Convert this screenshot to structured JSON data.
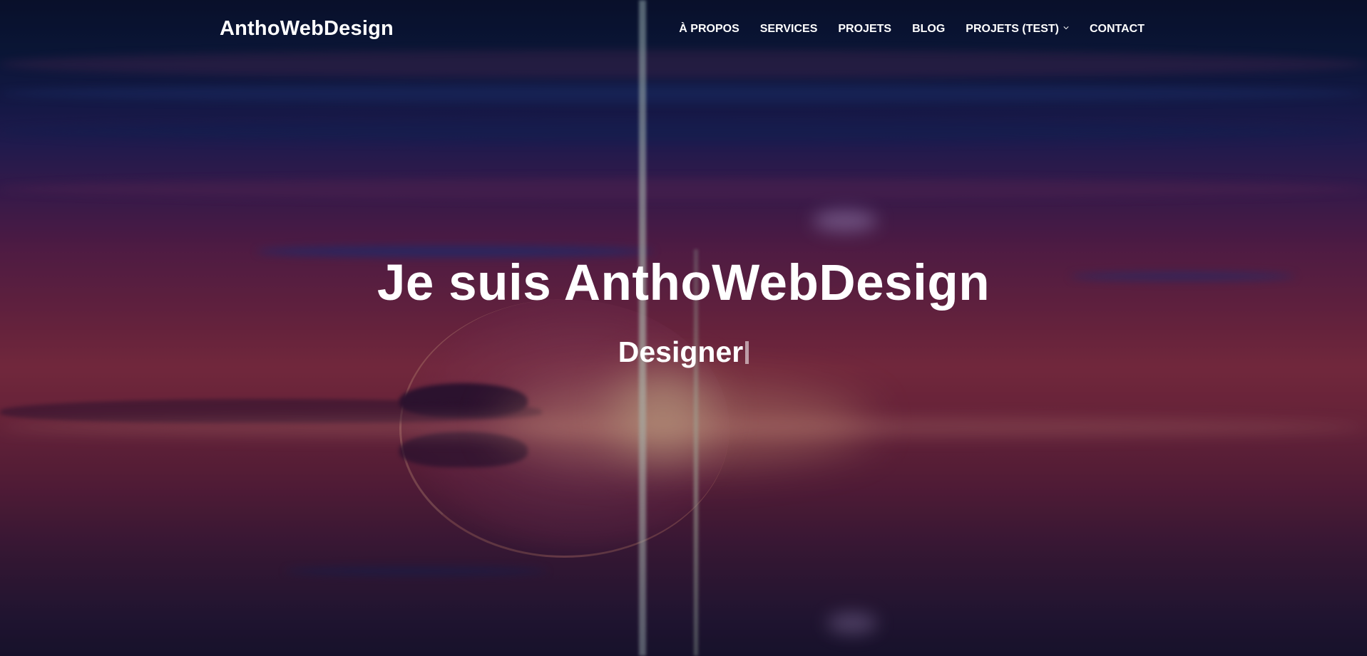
{
  "site": {
    "brand": "AnthoWebDesign"
  },
  "nav": {
    "items": [
      {
        "label": "À PROPOS"
      },
      {
        "label": "SERVICES"
      },
      {
        "label": "PROJETS"
      },
      {
        "label": "BLOG"
      },
      {
        "label": "PROJETS (TEST)",
        "icon": "chevron-down-icon"
      },
      {
        "label": "CONTACT"
      }
    ]
  },
  "hero": {
    "title": "Je suis AnthoWebDesign",
    "typed_text": "Designer"
  },
  "colors": {
    "text": "#ffffff",
    "sky_top": "#0a1230",
    "sky_mid": "#842a4a",
    "sky_bottom": "#1d1430"
  }
}
